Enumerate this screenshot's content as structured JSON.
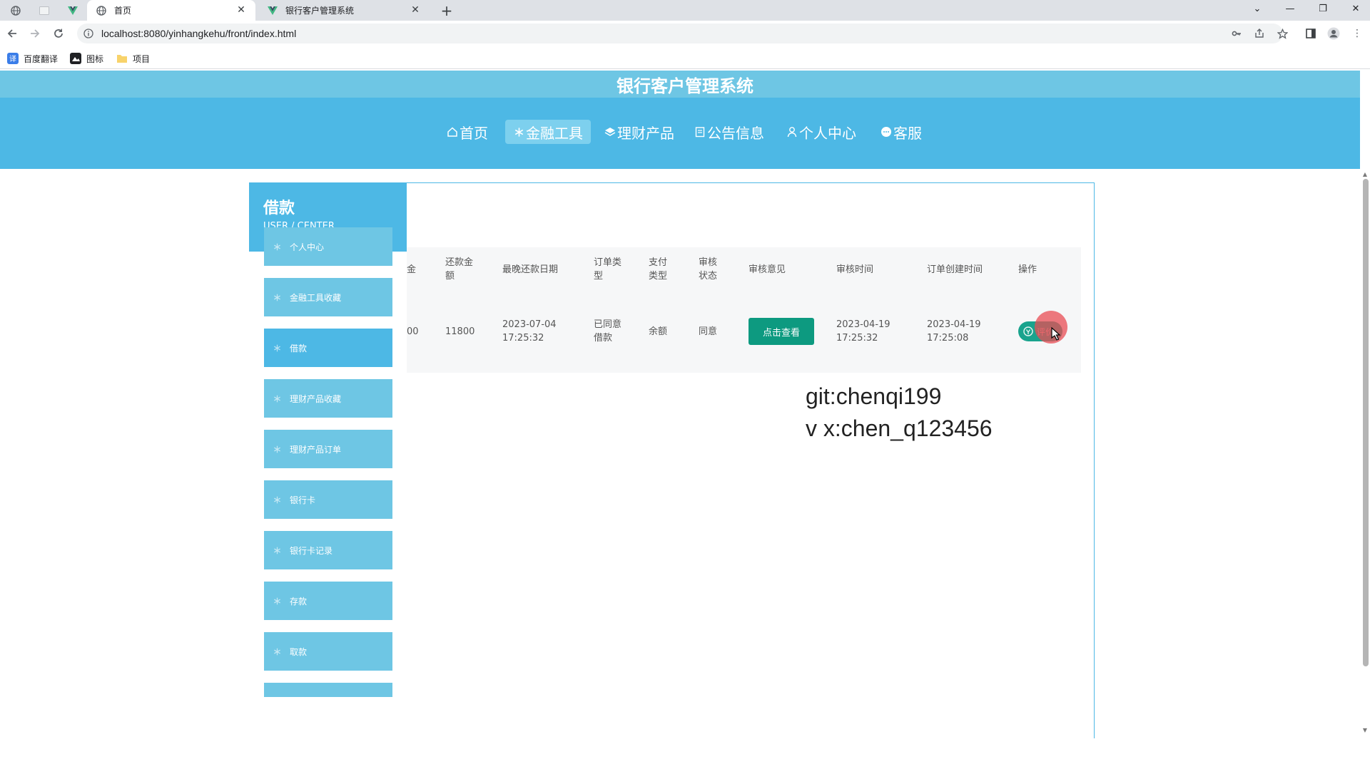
{
  "browser": {
    "tabs": [
      {
        "title": "首页",
        "active": true
      },
      {
        "title": "银行客户管理系统",
        "active": false
      }
    ],
    "url": "localhost:8080/yinhangkehu/front/index.html",
    "bookmarks": [
      {
        "label": "百度翻译",
        "icon": "translate-icon"
      },
      {
        "label": "图标",
        "icon": "image-icon"
      },
      {
        "label": "项目",
        "icon": "folder-icon"
      }
    ]
  },
  "site": {
    "title": "银行客户管理系统",
    "nav": [
      {
        "label": "首页",
        "icon": "home-icon",
        "active": false
      },
      {
        "label": "金融工具",
        "icon": "snowflake-icon",
        "active": true
      },
      {
        "label": "理财产品",
        "icon": "layers-icon",
        "active": false
      },
      {
        "label": "公告信息",
        "icon": "notice-icon",
        "active": false
      },
      {
        "label": "个人中心",
        "icon": "user-icon",
        "active": false
      },
      {
        "label": "客服",
        "icon": "chat-icon",
        "active": false
      }
    ]
  },
  "sidebar": {
    "title": "借款",
    "subtitle": "USER / CENTER",
    "items": [
      {
        "label": "个人中心",
        "active": false
      },
      {
        "label": "金融工具收藏",
        "active": false
      },
      {
        "label": "借款",
        "active": true
      },
      {
        "label": "理财产品收藏",
        "active": false
      },
      {
        "label": "理财产品订单",
        "active": false
      },
      {
        "label": "银行卡",
        "active": false
      },
      {
        "label": "银行卡记录",
        "active": false
      },
      {
        "label": "存款",
        "active": false
      },
      {
        "label": "取款",
        "active": false
      }
    ]
  },
  "table": {
    "headers": [
      "金",
      "还款金额",
      "最晚还款日期",
      "订单类型",
      "支付类型",
      "审核状态",
      "审核意见",
      "审核时间",
      "订单创建时间",
      "操作"
    ],
    "row": {
      "amount_partial": "00",
      "repay_amount": "11800",
      "latest_repay_date": "2023-07-04",
      "latest_repay_time": "17:25:32",
      "order_type": "已同意借款",
      "pay_type": "余额",
      "audit_status": "同意",
      "audit_opinion_button": "点击查看",
      "audit_date": "2023-04-19",
      "audit_time": "17:25:32",
      "created_date": "2023-04-19",
      "created_time": "17:25:08",
      "action_button": "评价"
    }
  },
  "watermark": {
    "line1": "git:chenqi199",
    "line2": "v x:chen_q123456"
  },
  "colors": {
    "primary": "#4db8e5",
    "primary_light": "#6ec6e4",
    "button_green": "#0d9a80"
  }
}
